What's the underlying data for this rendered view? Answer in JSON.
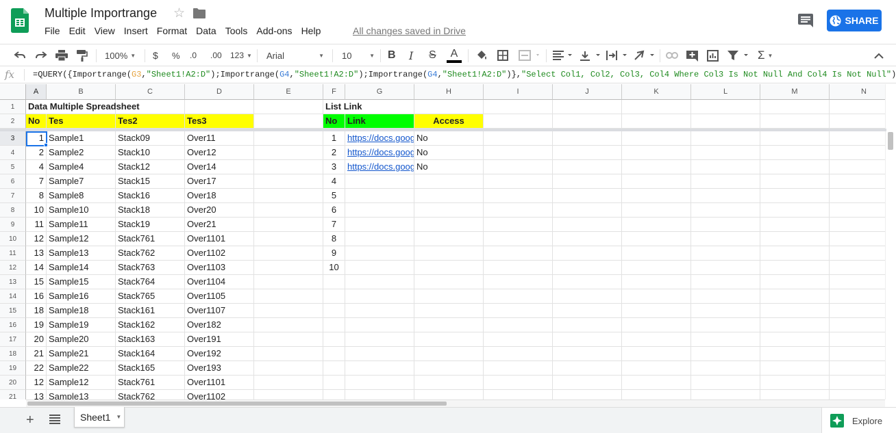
{
  "header": {
    "doc_title": "Multiple Importrange",
    "menu": [
      "File",
      "Edit",
      "View",
      "Insert",
      "Format",
      "Data",
      "Tools",
      "Add-ons",
      "Help"
    ],
    "save_status": "All changes saved in Drive",
    "share_label": "SHARE"
  },
  "toolbar": {
    "zoom": "100%",
    "currency": "$",
    "percent": "%",
    "decrease_decimal": ".0",
    "increase_decimal": ".00",
    "more_formats": "123",
    "font": "Arial",
    "font_size": "10",
    "bold": "B",
    "italic": "I",
    "strike": "S",
    "text_color": "A"
  },
  "formula_bar": {
    "fx_label": "fx",
    "formula": {
      "p1": "=QUERY({Importrange(",
      "r1": "G3",
      "p2": ",",
      "s1": "\"Sheet1!A2:D\"",
      "p3": ");Importrange(",
      "r2": "G4",
      "p4": ",",
      "s2": "\"Sheet1!A2:D\"",
      "p5": ");Importrange(",
      "r3": "G4",
      "p6": ",",
      "s3": "\"Sheet1!A2:D\"",
      "p7": ")},",
      "s4": "\"Select Col1, Col2, Col3, Col4 Where Col3 Is Not Null And Col4 Is Not Null\"",
      "p8": ")"
    }
  },
  "grid": {
    "columns": [
      "A",
      "B",
      "C",
      "D",
      "E",
      "F",
      "G",
      "H",
      "I",
      "J",
      "K",
      "L",
      "M",
      "N"
    ],
    "rows": [
      "1",
      "2",
      "3",
      "4",
      "5",
      "6",
      "7",
      "8",
      "9",
      "10",
      "11",
      "12",
      "13",
      "14",
      "15",
      "16",
      "17",
      "18",
      "19",
      "20",
      "21"
    ],
    "title_left": "Data Multiple Spreadsheet",
    "title_right": "List Link",
    "left_headers": [
      "No",
      "Tes",
      "Tes2",
      "Tes3"
    ],
    "right_headers": [
      "No",
      "Link",
      "Access"
    ],
    "data": [
      [
        "1",
        "Sample1",
        "Stack09",
        "Over11"
      ],
      [
        "2",
        "Sample2",
        "Stack10",
        "Over12"
      ],
      [
        "4",
        "Sample4",
        "Stack12",
        "Over14"
      ],
      [
        "7",
        "Sample7",
        "Stack15",
        "Over17"
      ],
      [
        "8",
        "Sample8",
        "Stack16",
        "Over18"
      ],
      [
        "10",
        "Sample10",
        "Stack18",
        "Over20"
      ],
      [
        "11",
        "Sample11",
        "Stack19",
        "Over21"
      ],
      [
        "12",
        "Sample12",
        "Stack761",
        "Over1101"
      ],
      [
        "13",
        "Sample13",
        "Stack762",
        "Over1102"
      ],
      [
        "14",
        "Sample14",
        "Stack763",
        "Over1103"
      ],
      [
        "15",
        "Sample15",
        "Stack764",
        "Over1104"
      ],
      [
        "16",
        "Sample16",
        "Stack765",
        "Over1105"
      ],
      [
        "18",
        "Sample18",
        "Stack161",
        "Over1107"
      ],
      [
        "19",
        "Sample19",
        "Stack162",
        "Over182"
      ],
      [
        "20",
        "Sample20",
        "Stack163",
        "Over191"
      ],
      [
        "21",
        "Sample21",
        "Stack164",
        "Over192"
      ],
      [
        "22",
        "Sample22",
        "Stack165",
        "Over193"
      ],
      [
        "12",
        "Sample12",
        "Stack761",
        "Over1101"
      ],
      [
        "13",
        "Sample13",
        "Stack762",
        "Over1102"
      ]
    ],
    "links": [
      [
        "1",
        "https://docs.goog",
        "No"
      ],
      [
        "2",
        "https://docs.goog",
        "No"
      ],
      [
        "3",
        "https://docs.goog",
        "No"
      ],
      [
        "4",
        "",
        ""
      ],
      [
        "5",
        "",
        ""
      ],
      [
        "6",
        "",
        ""
      ],
      [
        "7",
        "",
        ""
      ],
      [
        "8",
        "",
        ""
      ],
      [
        "9",
        "",
        ""
      ],
      [
        "10",
        "",
        ""
      ]
    ]
  },
  "sheets": {
    "tabs": [
      "Sheet1"
    ],
    "explore_label": "Explore"
  },
  "colors": {
    "header_yellow": "#ffff00",
    "header_green": "#00ff00",
    "share_blue": "#1a73e8",
    "sheets_green": "#0f9d58"
  }
}
